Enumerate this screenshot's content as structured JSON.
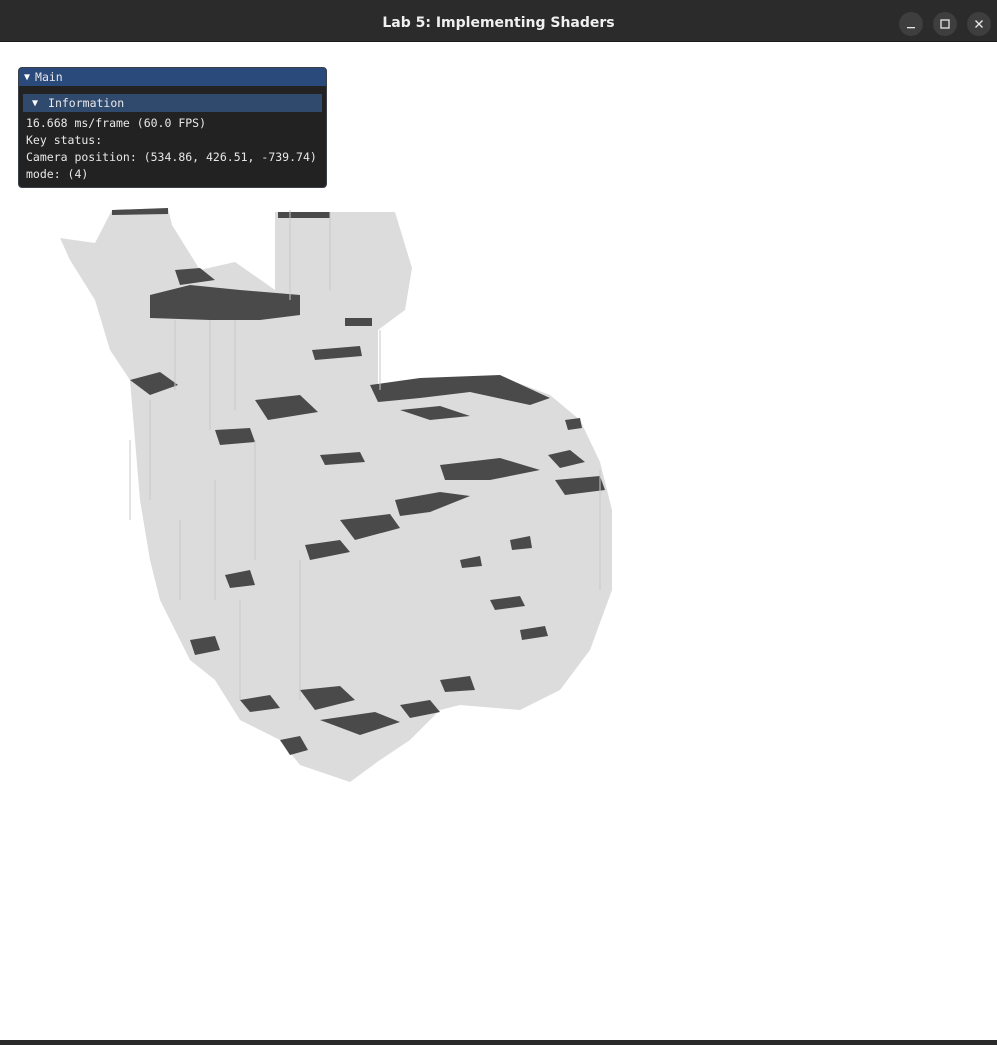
{
  "window": {
    "title": "Lab 5: Implementing Shaders",
    "buttons": {
      "minimize_icon": "minimize-icon",
      "maximize_icon": "maximize-icon",
      "close_icon": "close-icon"
    }
  },
  "imgui": {
    "window_title": "Main",
    "section_header": "Information",
    "lines": {
      "fps": "16.668 ms/frame (60.0 FPS)",
      "key_status": "Key status:",
      "camera": "Camera position: (534.86, 426.51, -739.74)",
      "mode": "mode: (4)"
    }
  },
  "colors": {
    "titlebar": "#2b2b2b",
    "imgui_title": "#294a7a",
    "imgui_header": "#2f4a6d",
    "voxel_light": "#dcdcdc",
    "voxel_dark": "#4a4a4a"
  }
}
